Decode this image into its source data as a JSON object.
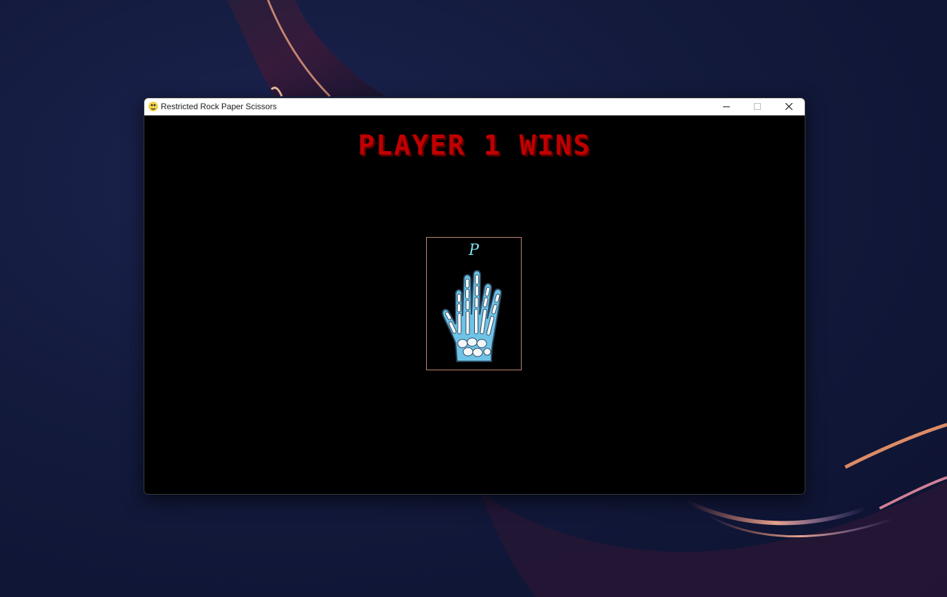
{
  "window": {
    "title": "Restricted Rock Paper Scissors"
  },
  "icons": {
    "app": "pygame-snake-icon",
    "minimize": "minimize-icon",
    "maximize": "maximize-icon",
    "close": "close-icon",
    "card_image": "skeleton-hand-paper-icon"
  },
  "game": {
    "result_text": "PLAYER 1 WINS",
    "card": {
      "letter": "P"
    }
  },
  "colors": {
    "result_text": "#c00000",
    "card_border": "#c28a73",
    "card_letter": "#7fe3f0",
    "hand_fill": "#6ec3e6",
    "background": "#000000"
  }
}
